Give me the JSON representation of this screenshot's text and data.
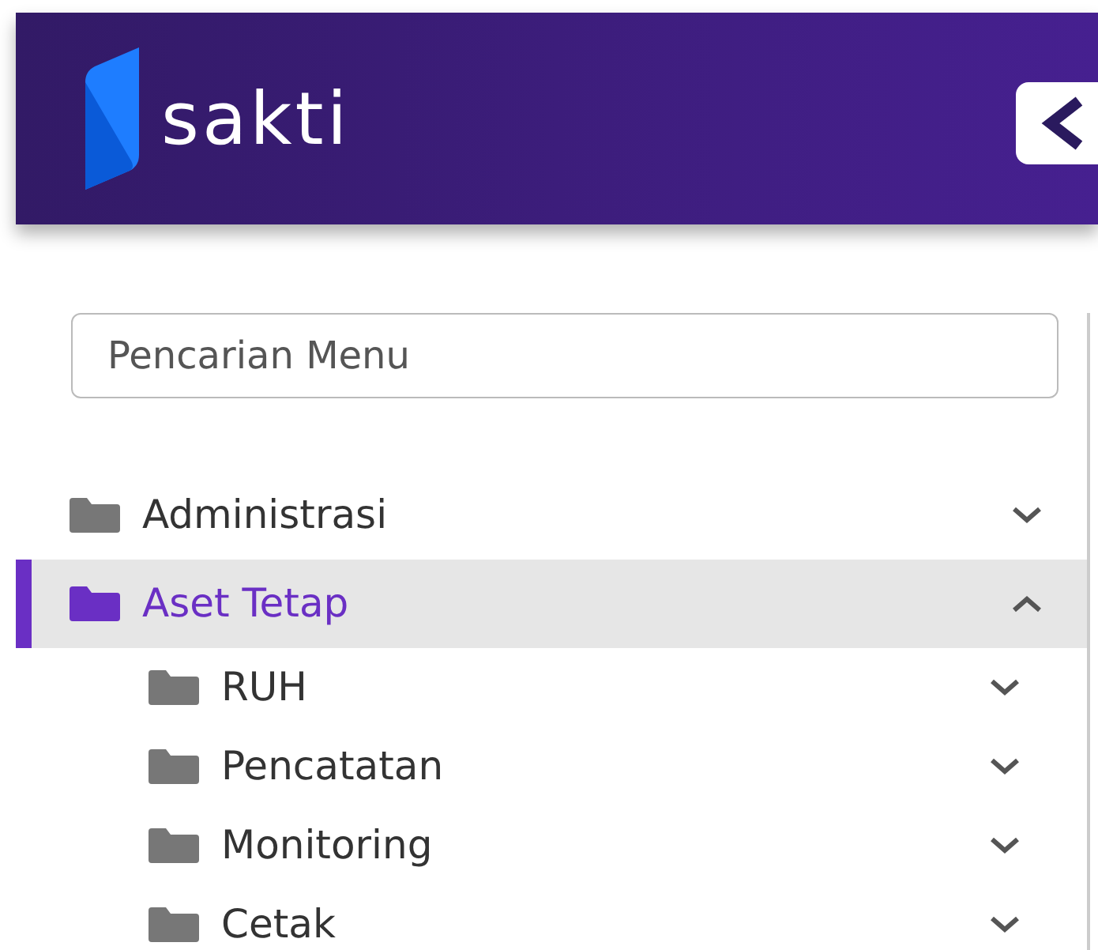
{
  "brand": {
    "name": "sakti"
  },
  "search": {
    "placeholder": "Pencarian Menu"
  },
  "menu": [
    {
      "label": "Administrasi",
      "selected": false,
      "expanded": false
    },
    {
      "label": "Aset Tetap",
      "selected": true,
      "expanded": true,
      "children": [
        {
          "label": "RUH",
          "expanded": false
        },
        {
          "label": "Pencatatan",
          "expanded": false
        },
        {
          "label": "Monitoring",
          "expanded": false
        },
        {
          "label": "Cetak",
          "expanded": false
        }
      ]
    }
  ]
}
